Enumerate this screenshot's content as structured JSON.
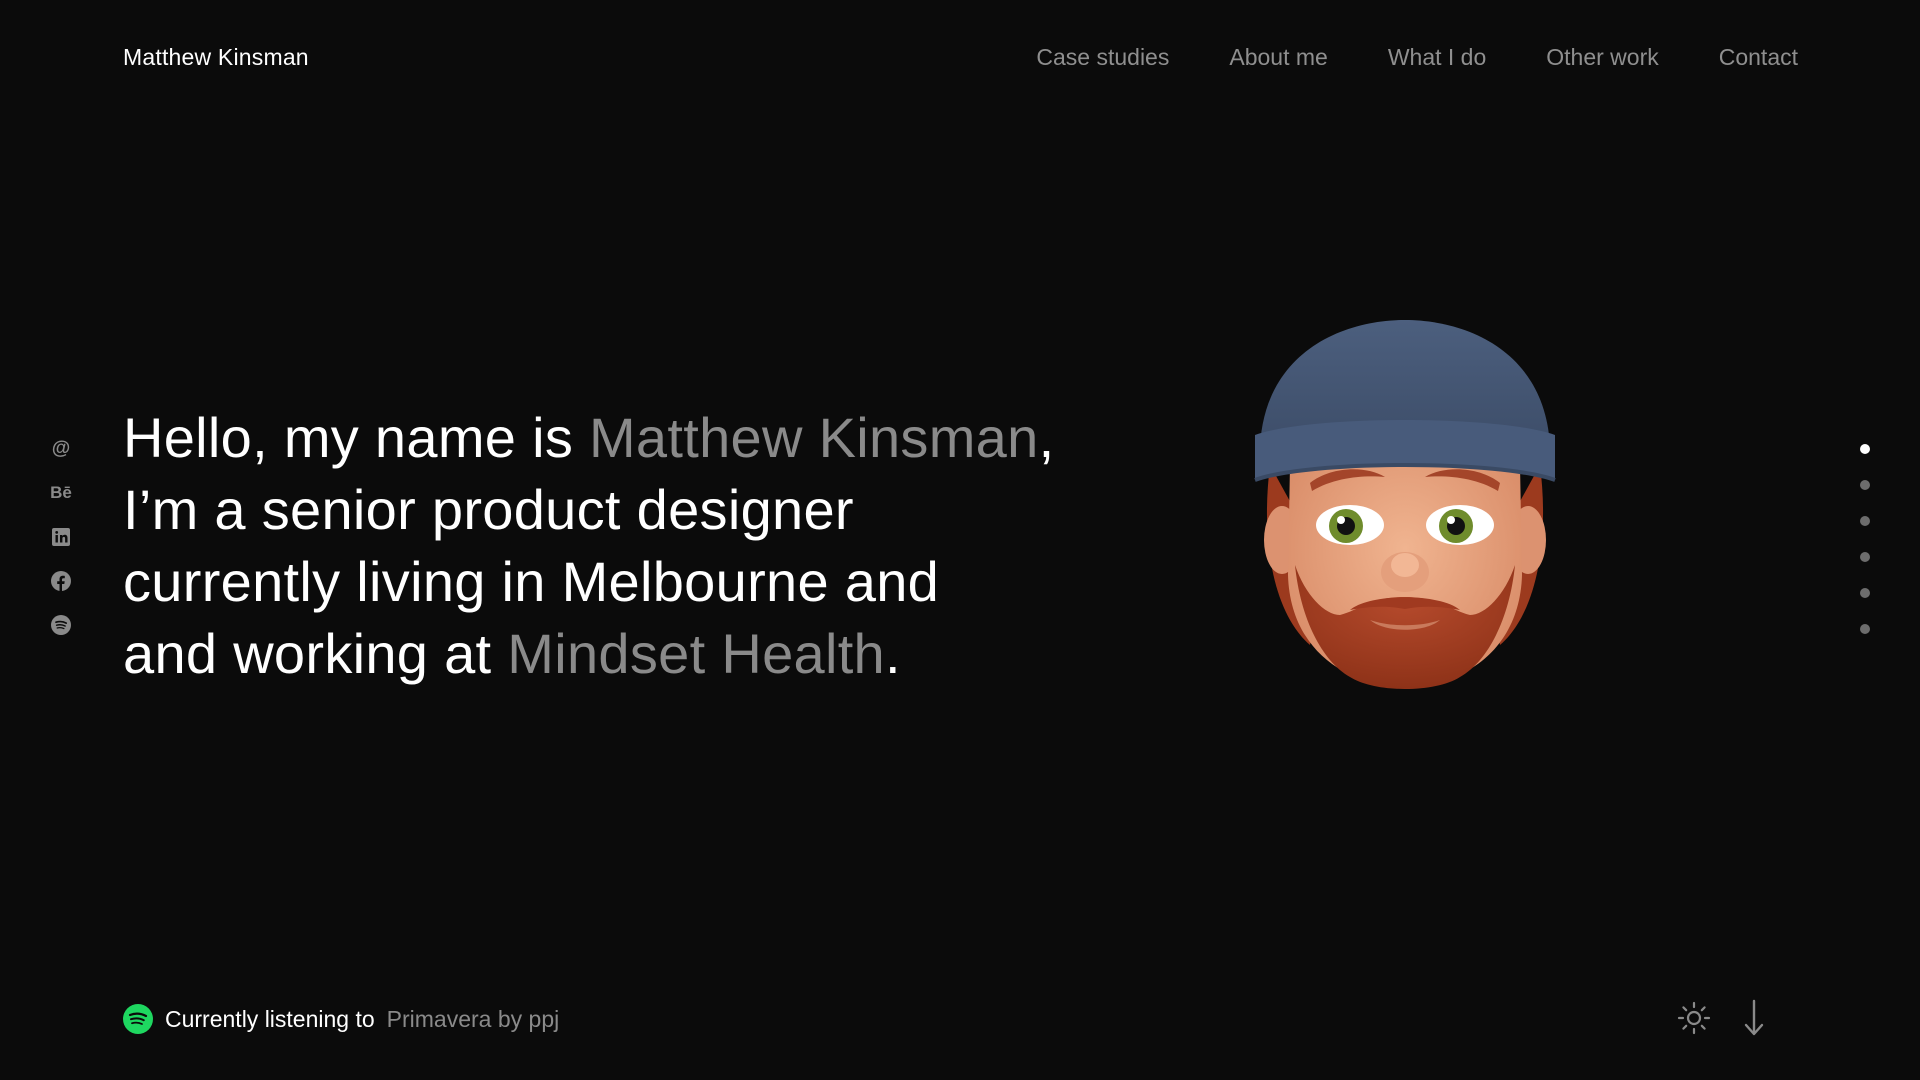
{
  "header": {
    "brand": "Matthew Kinsman",
    "nav": [
      {
        "label": "Case studies"
      },
      {
        "label": "About me"
      },
      {
        "label": "What I do"
      },
      {
        "label": "Other work"
      },
      {
        "label": "Contact"
      }
    ]
  },
  "social": [
    {
      "icon": "at-icon",
      "glyph": "@"
    },
    {
      "icon": "behance-icon",
      "glyph": "Bē"
    },
    {
      "icon": "linkedin-icon"
    },
    {
      "icon": "facebook-icon"
    },
    {
      "icon": "spotify-icon"
    }
  ],
  "hero": {
    "part1": "Hello, my name is ",
    "name": "Matthew Kinsman",
    "part2": ",",
    "line2": "I’m a senior product designer",
    "line3": "currently living in Melbourne and",
    "part4": "and working at ",
    "company": "Mindset Health",
    "part5": "."
  },
  "section_dots": {
    "count": 6,
    "active_index": 0
  },
  "footer": {
    "listening_label": "Currently listening to",
    "track": "Primavera by ppj",
    "icons": [
      "spotify-icon",
      "sun-icon",
      "arrow-down-icon"
    ]
  },
  "colors": {
    "background": "#0b0b0b",
    "text": "#ffffff",
    "muted": "#8a8a8a",
    "spotify": "#1ed760"
  }
}
